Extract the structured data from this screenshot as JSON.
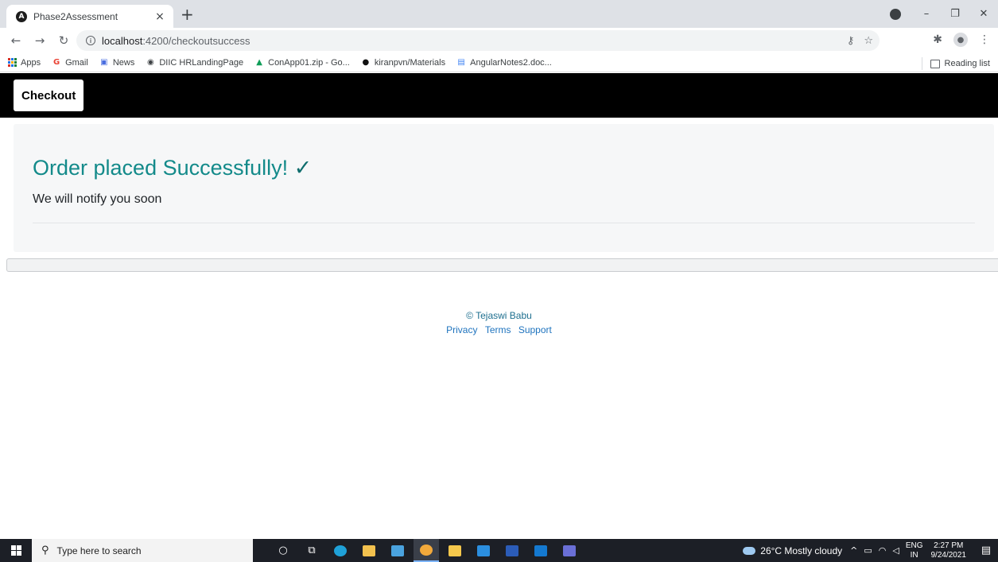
{
  "browser": {
    "tab_title": "Phase2Assessment",
    "url_host": "localhost",
    "url_path": ":4200/checkoutsuccess",
    "bookmarks": [
      {
        "label": "Apps",
        "icon": "apps-grid-icon"
      },
      {
        "label": "Gmail",
        "icon": "google-icon"
      },
      {
        "label": "News",
        "icon": "news-icon"
      },
      {
        "label": "DIIC HRLandingPage",
        "icon": "globe-icon"
      },
      {
        "label": "ConApp01.zip - Go...",
        "icon": "drive-icon"
      },
      {
        "label": "kiranpvn/Materials",
        "icon": "github-icon"
      },
      {
        "label": "AngularNotes2.doc...",
        "icon": "docs-icon"
      }
    ],
    "reading_list": "Reading list"
  },
  "navbar": {
    "checkout_label": "Checkout"
  },
  "main": {
    "heading": "Order placed Successfully!",
    "heading_check": "✓",
    "message": "We will notify you soon"
  },
  "footer": {
    "copyright": "© Tejaswi Babu",
    "links": [
      "Privacy",
      "Terms",
      "Support"
    ]
  },
  "taskbar": {
    "search_placeholder": "Type here to search",
    "weather": "26°C  Mostly cloudy",
    "lang_top": "ENG",
    "lang_bottom": "IN",
    "time": "2:27 PM",
    "date": "9/24/2021"
  },
  "colors": {
    "heading": "#138a8a",
    "navbar": "#000000",
    "link": "#1e73be"
  }
}
